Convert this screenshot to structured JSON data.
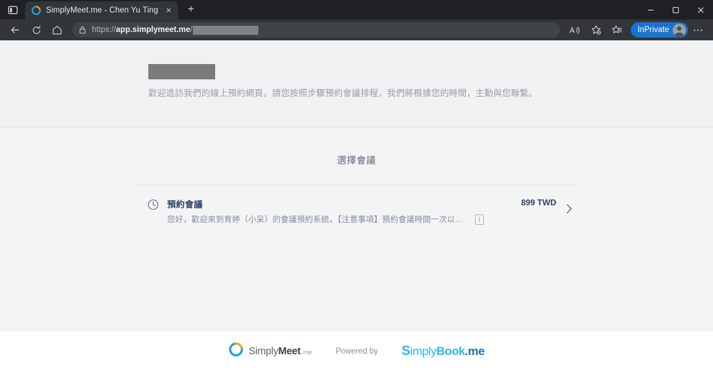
{
  "browser": {
    "tab": {
      "title": "SimplyMeet.me - Chen Yu Ting",
      "favicon_name": "simplymeet-favicon",
      "close_label": "×"
    },
    "new_tab_label": "+",
    "window_controls": {
      "minimize": "minimize-icon",
      "maximize": "maximize-icon",
      "close": "close-icon"
    },
    "toolbar": {
      "back": "back-arrow-icon",
      "refresh": "refresh-icon",
      "home": "home-icon",
      "lock": "lock-icon",
      "url_scheme": "https://",
      "url_host": "app.simplymeet.me",
      "url_sep": "/",
      "url_redacted": true,
      "read_aloud": "read-aloud-icon",
      "add_favorite": "add-favorite-icon",
      "favorites": "favorites-icon",
      "inprivate_label": "InPrivate",
      "avatar": "profile-avatar",
      "settings_more": "⋯"
    },
    "tab_strip_toggle": "tab-actions-icon"
  },
  "page": {
    "header": {
      "company_name_redacted": true,
      "welcome_text": "歡迎造訪我們的線上預約網頁。請您按照步驟預約會議排程，我們將根據您的時間，主動與您聯繫。"
    },
    "main": {
      "section_title": "選擇會議",
      "events": [
        {
          "icon": "clock-icon",
          "title": "預約會議",
          "description": "您好，歡迎來到育婷（小呆）的會議預約系統。【注意事項】預約會議時間一次以一小時為單位。如需預約...",
          "info_icon": "info-icon",
          "info_glyph": "i",
          "price": "899 TWD",
          "chevron": "chevron-right-icon"
        }
      ]
    },
    "footer": {
      "simplymeet": {
        "logo_name": "simplymeet-logo-mark",
        "word_simply": "Simply",
        "word_meet": "Meet",
        "word_tld": ".me"
      },
      "powered_by": "Powered by",
      "simplybook": {
        "logo_name": "simplybook-logo",
        "s": "S",
        "mid": "imply",
        "book": "Book",
        "dotme": ".me"
      }
    }
  },
  "colors": {
    "accent_blue": "#1b72d3",
    "brand_cyan": "#2bb6f0",
    "brand_dark_blue": "#1a6fad",
    "heading_slate": "#5c6b84",
    "title_navy": "#2f4468",
    "page_bg": "#f4f4f5",
    "header_bg": "#f0f1f3",
    "chrome_dark": "#323639",
    "titlebar_dark": "#202124"
  }
}
